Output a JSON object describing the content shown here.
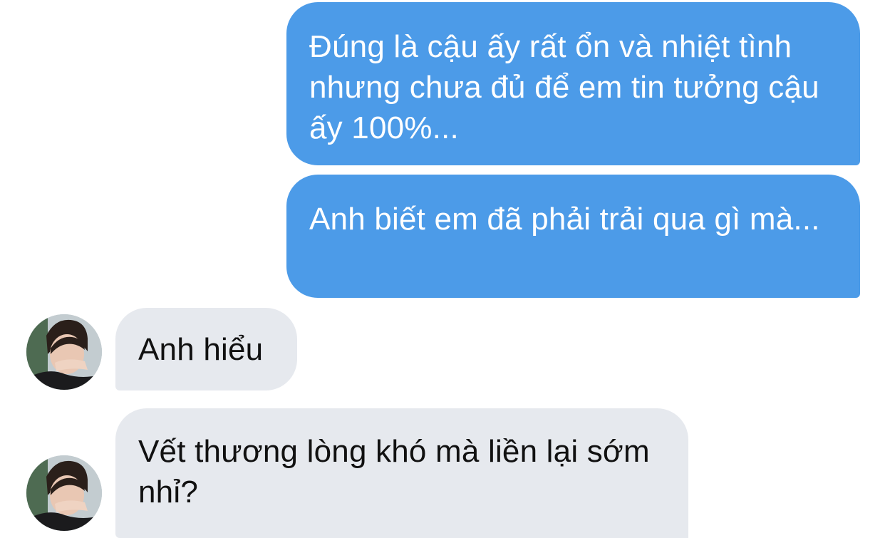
{
  "messages": [
    {
      "direction": "outgoing",
      "text": "Đúng là cậu ấy rất ổn và nhiệt tình nhưng chưa đủ để em tin tưởng cậu ấy 100%..."
    },
    {
      "direction": "outgoing",
      "text": "Anh biết em đã phải trải qua gì mà..."
    },
    {
      "direction": "incoming",
      "text": "Anh hiểu",
      "has_avatar": true
    },
    {
      "direction": "incoming",
      "text": "Vết thương lòng khó mà liền lại sớm nhỉ?",
      "has_avatar": true
    }
  ],
  "colors": {
    "outgoing_bubble": "#4c9be8",
    "outgoing_text": "#ffffff",
    "incoming_bubble": "#e6e9ee",
    "incoming_text": "#111111",
    "background": "#ffffff"
  },
  "icons": {
    "avatar": "contact-avatar-photo"
  }
}
